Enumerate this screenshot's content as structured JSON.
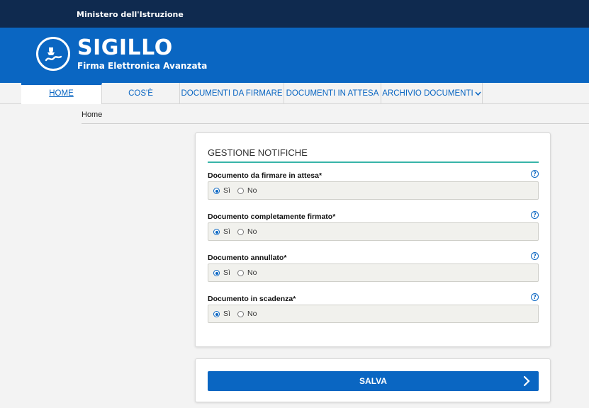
{
  "header": {
    "ministry": "Ministero dell'Istruzione",
    "brand_title": "SIGILLO",
    "brand_subtitle": "Firma Elettronica Avanzata",
    "top_color": "#0f2a4f",
    "brand_color": "#0a66c2"
  },
  "nav": {
    "items": [
      {
        "label": "HOME",
        "active": true
      },
      {
        "label": "COS'È",
        "active": false
      },
      {
        "label": "DOCUMENTI DA FIRMARE",
        "active": false
      },
      {
        "label": "DOCUMENTI IN ATTESA",
        "active": false
      },
      {
        "label": "ARCHIVIO DOCUMENTI",
        "active": false,
        "icon": "chevron-down-icon"
      }
    ]
  },
  "breadcrumb": "Home",
  "notifiche": {
    "title": "GESTIONE NOTIFICHE",
    "accent_color": "#37b4a8",
    "fields": [
      {
        "label": "Documento da firmare in attesa*",
        "option_yes": "Sì",
        "option_no": "No",
        "selected": "Sì"
      },
      {
        "label": "Documento completamente firmato*",
        "option_yes": "Sì",
        "option_no": "No",
        "selected": "Sì"
      },
      {
        "label": "Documento annullato*",
        "option_yes": "Sì",
        "option_no": "No",
        "selected": "Sì"
      },
      {
        "label": "Documento in scadenza*",
        "option_yes": "Sì",
        "option_no": "No",
        "selected": "Sì"
      }
    ],
    "help_icon": "help-circle-icon",
    "help_glyph": "?"
  },
  "actions": {
    "save_label": "SALVA"
  }
}
